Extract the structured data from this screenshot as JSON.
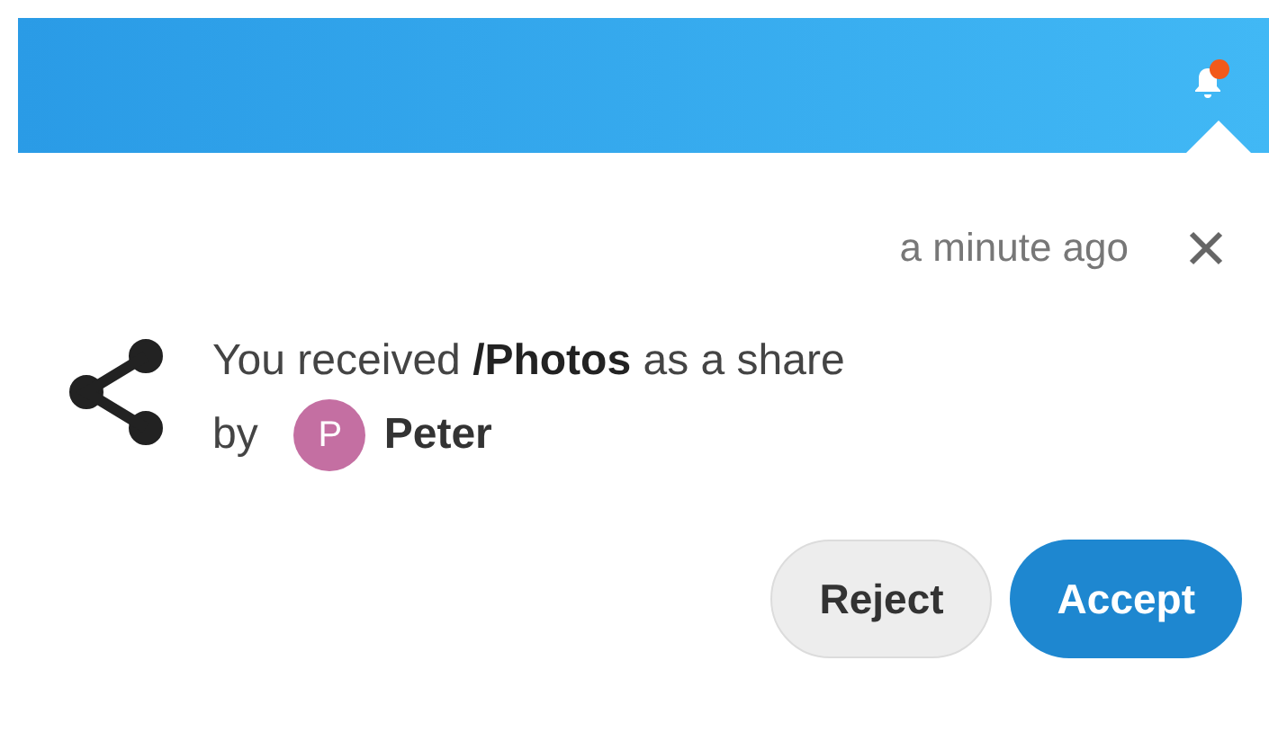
{
  "header": {
    "notifications_unread": true
  },
  "notification": {
    "time": "a minute ago",
    "message": "You received **/Photos** as a share",
    "by_label": "by",
    "user": {
      "initial": "P",
      "name": "Peter",
      "color": "#c46fa2"
    },
    "buttons": [
      {
        "label": "Reject",
        "kind": "secondary"
      },
      {
        "label": "Accept",
        "kind": "primary"
      }
    ]
  }
}
